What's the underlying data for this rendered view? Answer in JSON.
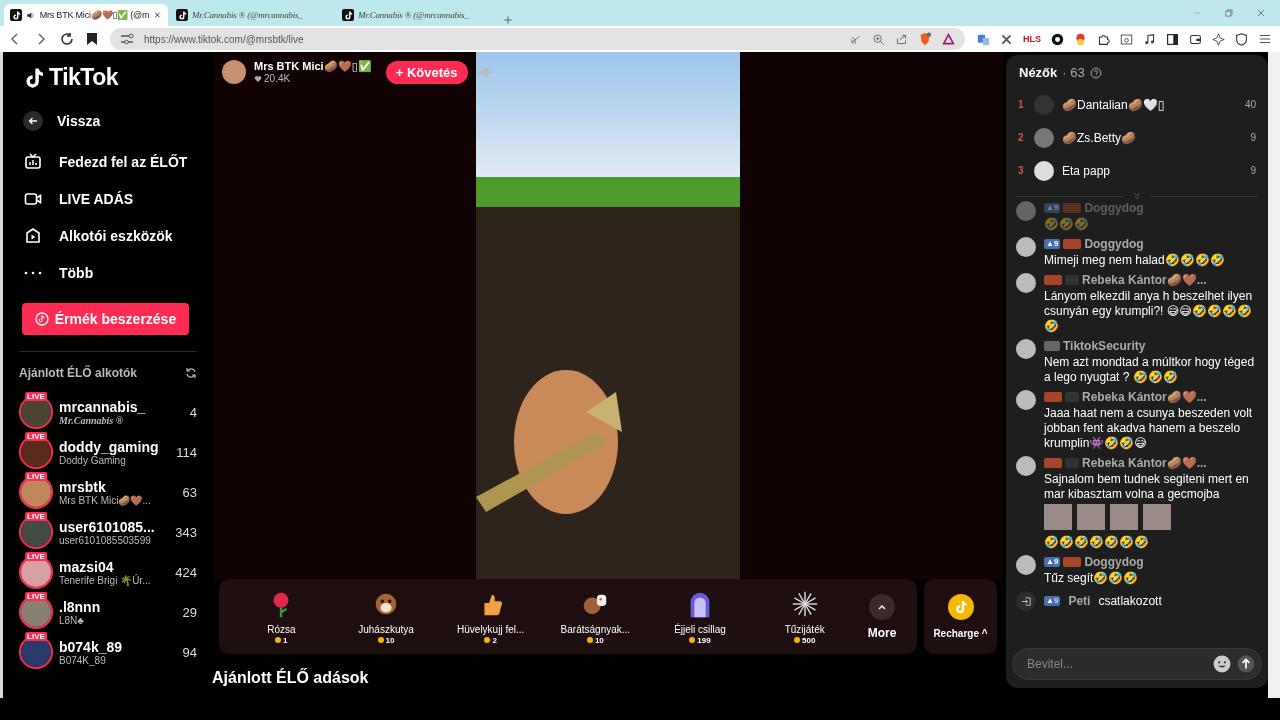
{
  "browser": {
    "tabs": [
      {
        "title": "Mrs BTK Mici🥔🤎▯✅ (@m",
        "selected": true,
        "kind": "tiktok",
        "audio": true
      },
      {
        "title": "Mr.Cannabis ® (@mrcannabis_",
        "selected": false,
        "kind": "tiktok",
        "audio": false
      },
      {
        "title": "Mr.Cannabis ® (@mrcannabis_",
        "selected": false,
        "kind": "tiktok",
        "audio": false
      }
    ],
    "url": "https://www.tiktok.com/@mrsbtk/live",
    "extension_label": "HLS"
  },
  "sidebar": {
    "logo": "TikTok",
    "back": "Vissza",
    "nav": [
      {
        "label": "Fedezd fel az ÉLŐT",
        "kind": "tv"
      },
      {
        "label": "LIVE ADÁS",
        "kind": "camera"
      },
      {
        "label": "Alkotói eszközök",
        "kind": "play"
      },
      {
        "label": "Több",
        "kind": "more"
      }
    ],
    "coins_button": "Érmék beszerzése",
    "section_title": "Ajánlott ÉLŐ alkotók",
    "creators": [
      {
        "username": "mrcannabis_",
        "display_name": "Mr.Cannabis ®",
        "viewers": "4",
        "live_badge": "LIVE"
      },
      {
        "username": "doddy_gaming",
        "display_name": "Doddy Gaming",
        "viewers": "114",
        "live_badge": "LIVE"
      },
      {
        "username": "mrsbtk",
        "display_name": "Mrs BTK Mici🥔🤎...",
        "viewers": "63",
        "live_badge": "LIVE"
      },
      {
        "username": "user6101085...",
        "display_name": "user6101085503599",
        "viewers": "343",
        "live_badge": "LIVE"
      },
      {
        "username": "mazsi04",
        "display_name": "Tenerife Brigi 🌴Úr...",
        "viewers": "424",
        "live_badge": "LIVE"
      },
      {
        "username": ".l8nnn",
        "display_name": "L8N♣",
        "viewers": "29",
        "live_badge": "LIVE"
      },
      {
        "username": "b074k_89",
        "display_name": "B074K_89",
        "viewers": "94",
        "live_badge": "LIVE"
      }
    ]
  },
  "stream": {
    "host_name": "Mrs BTK Mici🥔🤎▯✅",
    "likes": "20.4K",
    "follow_button": "+ Követés",
    "gifts": [
      {
        "name": "Rózsa",
        "price": "1",
        "kind": "rose"
      },
      {
        "name": "Juhászkutya",
        "price": "10",
        "kind": "dog"
      },
      {
        "name": "Hüvelykujj fel...",
        "price": "2",
        "kind": "thumb"
      },
      {
        "name": "Barátságnyak...",
        "price": "10",
        "kind": "bear"
      },
      {
        "name": "Éjjeli csillag",
        "price": "199",
        "kind": "arch"
      },
      {
        "name": "Tűzijáték",
        "price": "500",
        "kind": "firework"
      }
    ],
    "more_button": "More",
    "recharge_button": "Recharge ^",
    "recommended_title": "Ajánlott ÉLŐ adások"
  },
  "chat": {
    "title": "Nézők",
    "viewer_count": "· 63",
    "top_viewers": [
      {
        "rank": "1",
        "name": "🥔Dantalian🥔🤍▯",
        "score": "40"
      },
      {
        "rank": "2",
        "name": "🥔Zs.Betty🥔",
        "score": "9"
      },
      {
        "rank": "3",
        "name": "Eta papp",
        "score": "9"
      }
    ],
    "messages": [
      {
        "kind": "comment",
        "faded": true,
        "name": "Doggydog",
        "badges": [
          {
            "kind": "level",
            "text": "▲9"
          },
          {
            "kind": "fan"
          }
        ],
        "text": "🤣🤣🤣"
      },
      {
        "kind": "comment",
        "faded": false,
        "name": "Doggydog",
        "badges": [
          {
            "kind": "level",
            "text": "▲9"
          },
          {
            "kind": "fan"
          }
        ],
        "text": "Mimeji meg nem halad🤣🤣🤣🤣"
      },
      {
        "kind": "comment",
        "faded": false,
        "name": "Rebeka Kántor🥔🤎...",
        "badges": [
          {
            "kind": "fan"
          },
          {
            "kind": "friend"
          }
        ],
        "text": "Lányom elkezdil anya h beszelhet ilyen csunyán egy krumpli?! 😅😅🤣🤣🤣🤣🤣"
      },
      {
        "kind": "comment",
        "faded": false,
        "name": "TiktokSecurity",
        "badges": [
          {
            "kind": "mod"
          }
        ],
        "text": "Nem azt mondtad a múltkor hogy téged a lego nyugtat ? 🤣🤣🤣"
      },
      {
        "kind": "comment",
        "faded": false,
        "name": "Rebeka Kántor🥔🤎...",
        "badges": [
          {
            "kind": "fan"
          },
          {
            "kind": "friend"
          }
        ],
        "text": "Jaaa haat nem a csunya beszeden volt jobban fent akadva hanem a beszelo krumplin👾🤣🤣😅"
      },
      {
        "kind": "comment",
        "faded": false,
        "name": "Rebeka Kántor🥔🤎...",
        "badges": [
          {
            "kind": "fan"
          },
          {
            "kind": "friend"
          }
        ],
        "text": "Sajnalom bem tudnek segiteni mert en mar kibasztam volna a gecmojba",
        "media": [
          {
            "kind": "sticker"
          },
          {
            "kind": "sticker"
          },
          {
            "kind": "sticker"
          },
          {
            "kind": "sticker"
          }
        ],
        "after": "🤣🤣🤣🤣🤣🤣🤣"
      },
      {
        "kind": "comment",
        "faded": false,
        "name": "Doggydog",
        "badges": [
          {
            "kind": "level",
            "text": "▲9"
          },
          {
            "kind": "fan"
          }
        ],
        "text": "Tűz segít🤣🤣🤣"
      },
      {
        "kind": "join",
        "faded": false,
        "name": "Peti",
        "badges": [
          {
            "kind": "level",
            "text": "▲9"
          }
        ],
        "text": "csatlakozott"
      }
    ],
    "input": {
      "placeholder": "Bevitel..."
    }
  }
}
